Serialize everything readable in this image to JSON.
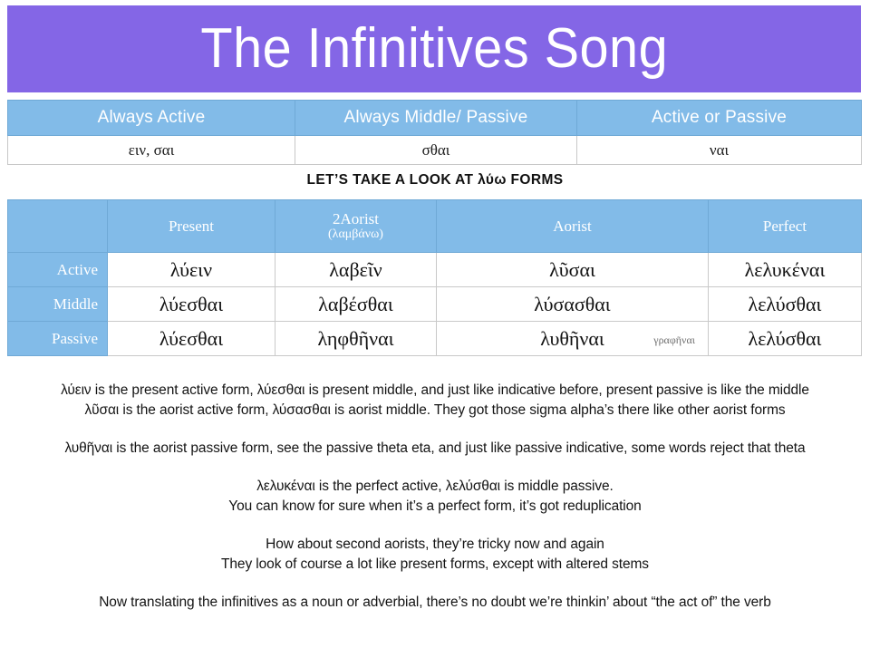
{
  "title": "The Infinitives Song",
  "colors": {
    "title_banner_bg": "#8466e6",
    "table_header_bg": "#82bbe8",
    "table_border": "#c8c8c8",
    "text": "#141414",
    "note_text": "#6e6e6e"
  },
  "endings_table": {
    "headers": [
      "Always Active",
      "Always Middle/ Passive",
      "Active or Passive"
    ],
    "values": [
      "ειν, σαι",
      "σθαι",
      "ναι"
    ]
  },
  "subtitle": "LET’S TAKE A LOOK AT λύω FORMS",
  "forms_table": {
    "corner_label": "",
    "columns": [
      {
        "main": "Present",
        "sub": ""
      },
      {
        "main": "2Aorist",
        "sub": "(λαμβάνω)"
      },
      {
        "main": "Aorist",
        "sub": ""
      },
      {
        "main": "Perfect",
        "sub": ""
      }
    ],
    "rows": [
      {
        "label": "Active",
        "cells": [
          {
            "form": "λύειν",
            "note": ""
          },
          {
            "form": "λαβεῖν",
            "note": ""
          },
          {
            "form": "λῦσαι",
            "note": ""
          },
          {
            "form": "λελυκέναι",
            "note": ""
          }
        ]
      },
      {
        "label": "Middle",
        "cells": [
          {
            "form": "λύεσθαι",
            "note": ""
          },
          {
            "form": "λαβέσθαι",
            "note": ""
          },
          {
            "form": "λύσασθαι",
            "note": ""
          },
          {
            "form": "λελύσθαι",
            "note": ""
          }
        ]
      },
      {
        "label": "Passive",
        "cells": [
          {
            "form": "λύεσθαι",
            "note": ""
          },
          {
            "form": "ληφθῆναι",
            "note": ""
          },
          {
            "form": "λυθῆναι",
            "note": "γραφῆναι"
          },
          {
            "form": "λελύσθαι",
            "note": ""
          }
        ]
      }
    ]
  },
  "lyrics": {
    "stanzas": [
      {
        "lines": [
          "λύειν is the present active form, λύεσθαι is present middle, and just like indicative before, present passive is like the middle",
          "λῦσαι is the aorist active form, λύσασθαι is aorist middle.  They got those sigma alpha’s there like other aorist forms"
        ]
      },
      {
        "lines": [
          "λυθῆναι is the aorist passive form, see the passive theta eta, and just like passive indicative, some words reject that theta"
        ]
      },
      {
        "lines": [
          "λελυκέναι is the perfect active, λελύσθαι is middle passive.",
          "You can know for sure when it’s a perfect form, it’s got reduplication"
        ]
      },
      {
        "lines": [
          "How about second aorists, they’re tricky now and again",
          "They look of course a lot like present forms, except with altered stems"
        ]
      },
      {
        "lines": [
          "Now translating the infinitives as a noun or adverbial, there’s no doubt we’re thinkin’ about “the act of” the verb"
        ]
      }
    ]
  }
}
